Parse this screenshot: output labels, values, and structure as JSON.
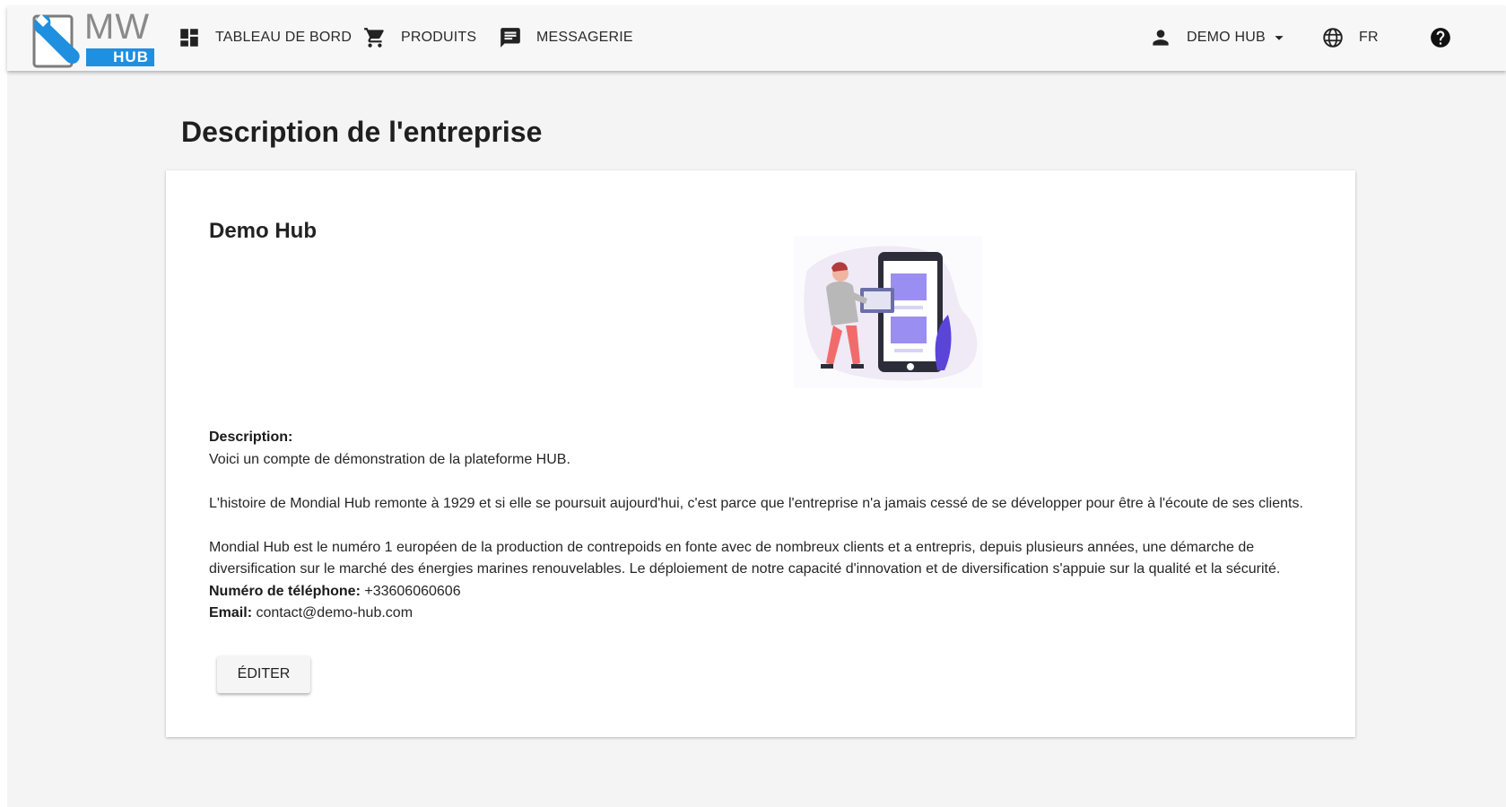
{
  "brand": {
    "logo_text": "MW",
    "logo_sub": "HUB",
    "accent": "#1f8fe0"
  },
  "nav": {
    "items": [
      {
        "label": "TABLEAU DE BORD",
        "icon": "dashboard-icon"
      },
      {
        "label": "PRODUITS",
        "icon": "cart-icon"
      },
      {
        "label": "MESSAGERIE",
        "icon": "message-icon"
      }
    ],
    "user_label": "DEMO HUB",
    "user_icon": "person-icon",
    "language": "FR",
    "language_icon": "globe-icon",
    "help_icon": "help-icon"
  },
  "page": {
    "title": "Description de l'entreprise"
  },
  "company": {
    "name": "Demo Hub",
    "description_label": "Description:",
    "description_lines": [
      "Voici un compte de démonstration de la plateforme HUB.",
      "L'histoire de Mondial Hub remonte à 1929 et si elle se poursuit aujourd'hui, c'est parce que l'entreprise n'a jamais cessé de se développer pour être à l'écoute de ses clients.",
      "Mondial Hub est le numéro 1 européen de la production de contrepoids en fonte avec de nombreux clients et a entrepris, depuis plusieurs années, une démarche de diversification sur le marché des énergies marines renouvelables. Le déploiement de notre capacité d'innovation et de diversification s'appuie sur la qualité et la sécurité."
    ],
    "phone_label": "Numéro de téléphone:",
    "phone": "+33606060606",
    "email_label": "Email:",
    "email": "contact@demo-hub.com",
    "edit_label": "ÉDITER"
  }
}
